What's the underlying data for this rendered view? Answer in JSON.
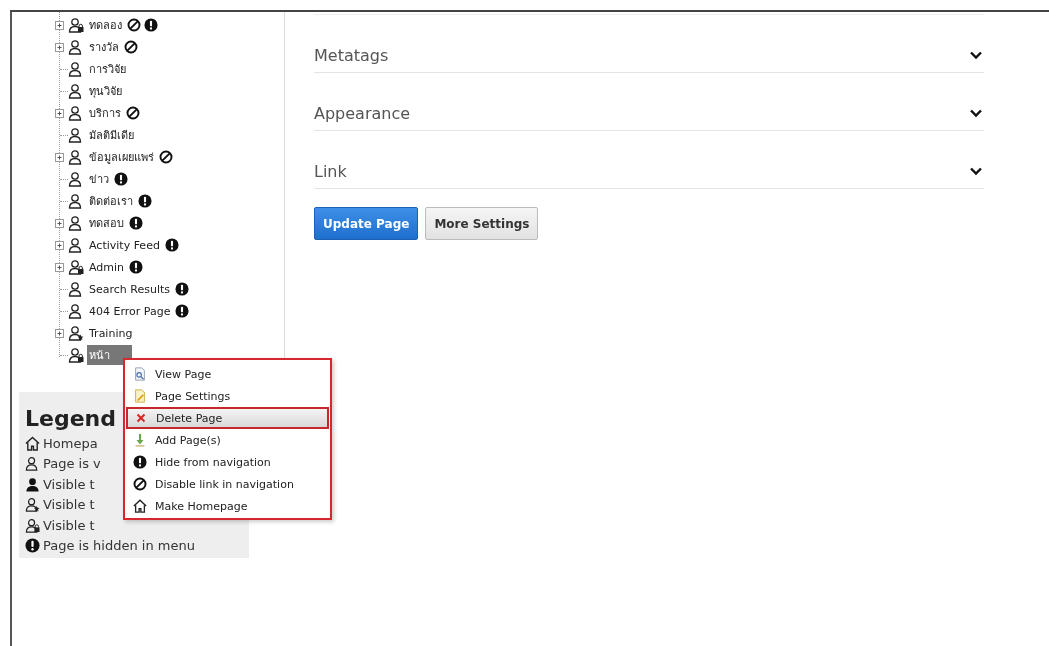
{
  "tree": {
    "items": [
      {
        "label": "ทดลอง",
        "kind": "lock",
        "collapsed": true,
        "link_disabled": true,
        "hidden": true,
        "selected": false
      },
      {
        "label": "รางวัล",
        "kind": "user",
        "collapsed": true,
        "link_disabled": true,
        "hidden": false,
        "selected": false
      },
      {
        "label": "การวิจัย",
        "kind": "user",
        "collapsed": false,
        "link_disabled": false,
        "hidden": false,
        "selected": false
      },
      {
        "label": "ทุนวิจัย",
        "kind": "user",
        "collapsed": false,
        "link_disabled": false,
        "hidden": false,
        "selected": false
      },
      {
        "label": "บริการ",
        "kind": "user",
        "collapsed": true,
        "link_disabled": true,
        "hidden": false,
        "selected": false
      },
      {
        "label": "มัลติมีเดีย",
        "kind": "user",
        "collapsed": false,
        "link_disabled": false,
        "hidden": false,
        "selected": false
      },
      {
        "label": "ข้อมูลเผยแพร่",
        "kind": "user",
        "collapsed": true,
        "link_disabled": true,
        "hidden": false,
        "selected": false
      },
      {
        "label": "ข่าว",
        "kind": "user",
        "collapsed": false,
        "link_disabled": false,
        "hidden": true,
        "selected": false
      },
      {
        "label": "ติดต่อเรา",
        "kind": "user",
        "collapsed": false,
        "link_disabled": false,
        "hidden": true,
        "selected": false
      },
      {
        "label": "ทดสอบ",
        "kind": "user",
        "collapsed": true,
        "link_disabled": false,
        "hidden": true,
        "selected": false
      },
      {
        "label": "Activity Feed",
        "kind": "user",
        "collapsed": true,
        "link_disabled": false,
        "hidden": true,
        "selected": false
      },
      {
        "label": "Admin",
        "kind": "lock",
        "collapsed": true,
        "link_disabled": false,
        "hidden": true,
        "selected": false
      },
      {
        "label": "Search Results",
        "kind": "user",
        "collapsed": false,
        "link_disabled": false,
        "hidden": true,
        "selected": false
      },
      {
        "label": "404 Error Page",
        "kind": "user",
        "collapsed": false,
        "link_disabled": false,
        "hidden": true,
        "selected": false
      },
      {
        "label": "Training",
        "kind": "star",
        "collapsed": true,
        "link_disabled": false,
        "hidden": false,
        "selected": false
      },
      {
        "label": "หน้า",
        "kind": "lock",
        "collapsed": false,
        "link_disabled": false,
        "hidden": false,
        "selected": true
      }
    ]
  },
  "legend": {
    "title": "Legend",
    "items": [
      {
        "kind": "home",
        "text": "Homepa"
      },
      {
        "kind": "user",
        "text": "Page is v"
      },
      {
        "kind": "filled",
        "text": "Visible t"
      },
      {
        "kind": "star",
        "text": "Visible t"
      },
      {
        "kind": "lock",
        "text": "Visible t"
      },
      {
        "kind": "hidden",
        "text": "Page is hidden in menu"
      }
    ]
  },
  "context_menu": {
    "items": [
      {
        "kind": "view",
        "label": "View Page",
        "selected": false
      },
      {
        "kind": "settings",
        "label": "Page Settings",
        "selected": false
      },
      {
        "kind": "delete",
        "label": "Delete Page",
        "selected": true
      },
      {
        "kind": "add",
        "label": "Add Page(s)",
        "selected": false
      },
      {
        "kind": "hidden",
        "label": "Hide from navigation",
        "selected": false
      },
      {
        "kind": "disabled",
        "label": "Disable link in navigation",
        "selected": false
      },
      {
        "kind": "home",
        "label": "Make Homepage",
        "selected": false
      }
    ]
  },
  "sections": [
    {
      "title": "Metatags",
      "expanded": false
    },
    {
      "title": "Appearance",
      "expanded": false
    },
    {
      "title": "Link",
      "expanded": false
    }
  ],
  "buttons": [
    {
      "label": "Update Page",
      "primary": true
    },
    {
      "label": "More Settings",
      "primary": false
    }
  ]
}
